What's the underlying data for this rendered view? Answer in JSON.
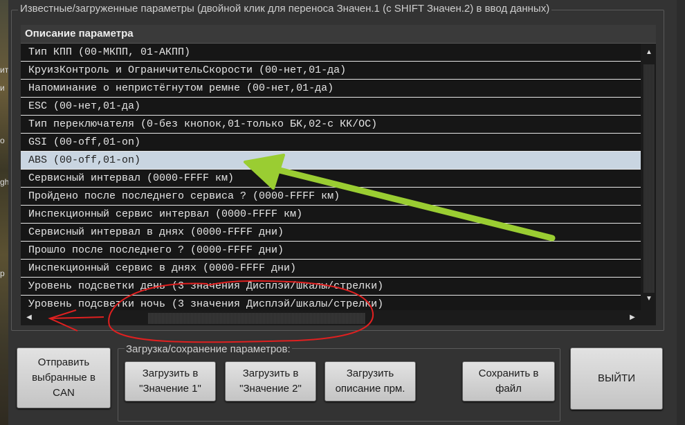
{
  "window": {
    "group_title": "Известные/загруженные параметры (двойной клик для переноса Значен.1 (с SHIFT Значен.2) в ввод данных)",
    "left_strip_fragments": [
      "ит",
      "и",
      "о",
      "gh",
      "р"
    ]
  },
  "grid": {
    "header": "Описание параметра",
    "rows": [
      "Тип КПП (00-МКПП, 01-АКПП)",
      "КруизКонтроль и ОграничительСкорости (00-нет,01-да)",
      "Напоминание о непристёгнутом ремне (00-нет,01-да)",
      "ESC (00-нет,01-да)",
      "Тип переключателя (0-без кнопок,01-только БК,02-с КК/ОС)",
      "GSI (00-off,01-on)",
      "ABS (00-off,01-on)",
      "Сервисный интервал (0000-FFFF км)",
      "Пройдено после последнего сервиса ? (0000-FFFF км)",
      "Инспекционный сервис интервал (0000-FFFF км)",
      "Сервисный интервал в днях (0000-FFFF дни)",
      "Прошло после последнего ? (0000-FFFF дни)",
      "Инспекционный сервис в днях (0000-FFFF дни)",
      "Уровень подсветки день (3 значения Дисплэй/шкалы/стрелки)",
      "Уровень подсветки ночь (3 значения Дисплэй/шкалы/стрелки)"
    ],
    "selected_index": 6,
    "icons": {
      "scroll_up": "▲",
      "scroll_down": "▼",
      "scroll_left": "◀",
      "scroll_right": "▶"
    }
  },
  "buttons": {
    "send": "Отправить\nвыбранные в\nCAN",
    "load1": "Загрузить в\n\"Значение 1\"",
    "load2": "Загрузить в\n\"Значение 2\"",
    "load_desc": "Загрузить\nописание прм.",
    "save": "Сохранить в\nфайл",
    "exit": "ВЫЙТИ"
  },
  "group2_title": "Загрузка/сохранение параметров:",
  "colors": {
    "selection": "#c9d5e1",
    "annotation_green": "#9acd32",
    "annotation_red": "#e02020"
  }
}
